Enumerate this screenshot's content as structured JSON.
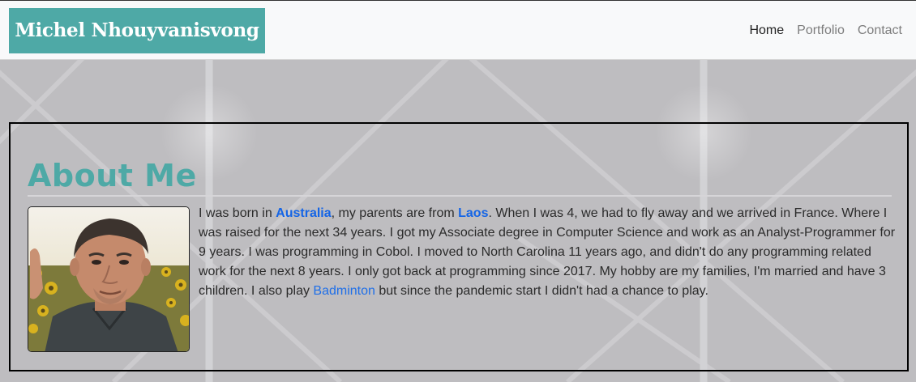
{
  "brand": {
    "name": "Michel Nhouyvanisvong"
  },
  "nav": {
    "items": [
      {
        "label": "Home",
        "active": true
      },
      {
        "label": "Portfolio",
        "active": false
      },
      {
        "label": "Contact",
        "active": false
      }
    ]
  },
  "about": {
    "title": "About Me",
    "bio": {
      "t1": "I was born in ",
      "link_australia": "Australia",
      "t2": ", my parents are from ",
      "link_laos": "Laos",
      "t3": ". When I was 4, we had to fly away and we arrived in France. Where I was raised for the next 34 years. I got my Associate degree in Computer Science and work as an Analyst-Programmer for 9 years. I was programming in Cobol. I moved to North Carolina 11 years ago, and didn't do any programming related work for the next 8 years. I only got back at programming since 2017. My hobby are my families, I'm married and have 3 children. I also play ",
      "link_badminton": "Badminton",
      "t4": " but since the pandemic start I didn't had a chance to play."
    }
  },
  "colors": {
    "accent": "#4ea9a6",
    "link": "#1565e6",
    "background": "#bdbcbf",
    "navbar": "#f8f9fa"
  }
}
